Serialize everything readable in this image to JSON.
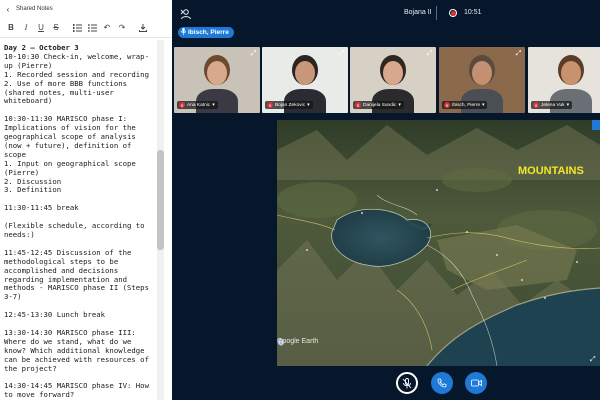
{
  "notes": {
    "title": "Shared Notes",
    "toolbar": [
      "B",
      "I",
      "U",
      "S",
      "ordered-list",
      "bullet-list",
      "undo",
      "redo",
      "export"
    ],
    "lines": [
      {
        "t": "Day 2 – October 3",
        "b": true
      },
      {
        "t": "10-10:30 Check-in, welcome, wrap-up (Pierre)"
      },
      {
        "t": "1. Recorded session and recording"
      },
      {
        "t": "2. Use of more BBB functions (shared notes, multi-user whiteboard)"
      },
      {
        "t": ""
      },
      {
        "t": "10:30-11:30 MARISCO phase I: Implications of vision for the geographical scope of analysis (now + future), definition of scope"
      },
      {
        "t": "1. Input on geographical scope (Pierre)"
      },
      {
        "t": "2. Discussion"
      },
      {
        "t": "3. Definition"
      },
      {
        "t": ""
      },
      {
        "t": "11:30-11:45 break"
      },
      {
        "t": ""
      },
      {
        "t": "(Flexible schedule, according to needs:)"
      },
      {
        "t": ""
      },
      {
        "t": "11:45-12:45 Discussion of the methodological steps to be accomplished and decisions regarding implementation and methods - MARISCO phase II (Steps 3-7)"
      },
      {
        "t": ""
      },
      {
        "t": "12:45-13:30 Lunch break"
      },
      {
        "t": ""
      },
      {
        "t": "13:30-14:30 MARISCO phase III: Where do we stand, what do we know? Which additional knowledge can be achieved with resources of the project?"
      },
      {
        "t": ""
      },
      {
        "t": "14:30-14:45 MARISCO phase IV: How to move forward?"
      }
    ]
  },
  "topbar": {
    "meeting_title": "Bojana II",
    "recording_time": "10:51"
  },
  "talker": "Ibisch, Pierre",
  "participants": [
    {
      "name": "Ana Katnic",
      "bg": "#c9c2b8",
      "skin": "#d9a98b",
      "hair": "#6b4a2e",
      "shirt": "#3b3a44"
    },
    {
      "name": "Bojan Zekovic",
      "bg": "#e9ebe8",
      "skin": "#c9977a",
      "hair": "#2b2420",
      "shirt": "#2a2c33"
    },
    {
      "name": "Danijela Sundic",
      "bg": "#d7d0c5",
      "skin": "#d8a88c",
      "hair": "#2e2622",
      "shirt": "#2b2b2d"
    },
    {
      "name": "Ibisch, Pierre",
      "bg": "#8a6a4a",
      "skin": "#c58f72",
      "hair": "#5b4a3e",
      "shirt": "#4a4e55"
    },
    {
      "name": "Jelena Vuk",
      "bg": "#e6e2dc",
      "skin": "#c9926f",
      "hair": "#5a3d28",
      "shirt": "#6a6f76"
    }
  ],
  "share": {
    "label": "MOUNTAINS",
    "watermark": "Google Earth"
  },
  "colors": {
    "accent": "#1e7ad6",
    "background": "#06172b",
    "mute": "#d9333e",
    "recording": "#e0323a",
    "label": "#f2e72a"
  }
}
